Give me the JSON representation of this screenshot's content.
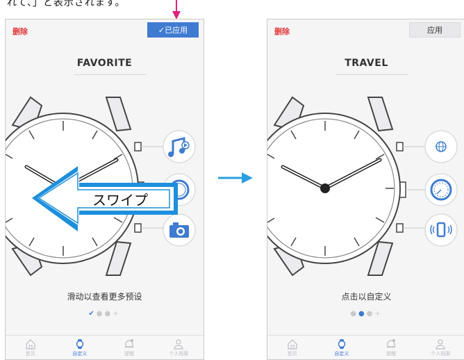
{
  "annotation": {
    "top_note": "れて、」と表示されます。",
    "swipe_label": "スワイプ"
  },
  "screens": [
    {
      "delete_label": "删除",
      "apply_label": "✓已应用",
      "title": "FAVORITE",
      "caption": "滑动以查看更多预设",
      "complications": [
        "music-icon",
        "dial-icon",
        "camera-icon"
      ]
    },
    {
      "delete_label": "删除",
      "apply_label": "应用",
      "title": "TRAVEL",
      "caption": "点击以自定义",
      "complications": [
        "globe-icon",
        "gauge-icon",
        "phone-vibrate-icon"
      ]
    }
  ],
  "tabbar": {
    "home": "首页",
    "custom": "自定义",
    "reminder": "提醒",
    "profile": "个人档案"
  },
  "colors": {
    "accent": "#3f7bd1",
    "delete": "#e23a3a",
    "annotation_arrow": "#2a9fe0",
    "marker": "#e0217a"
  }
}
